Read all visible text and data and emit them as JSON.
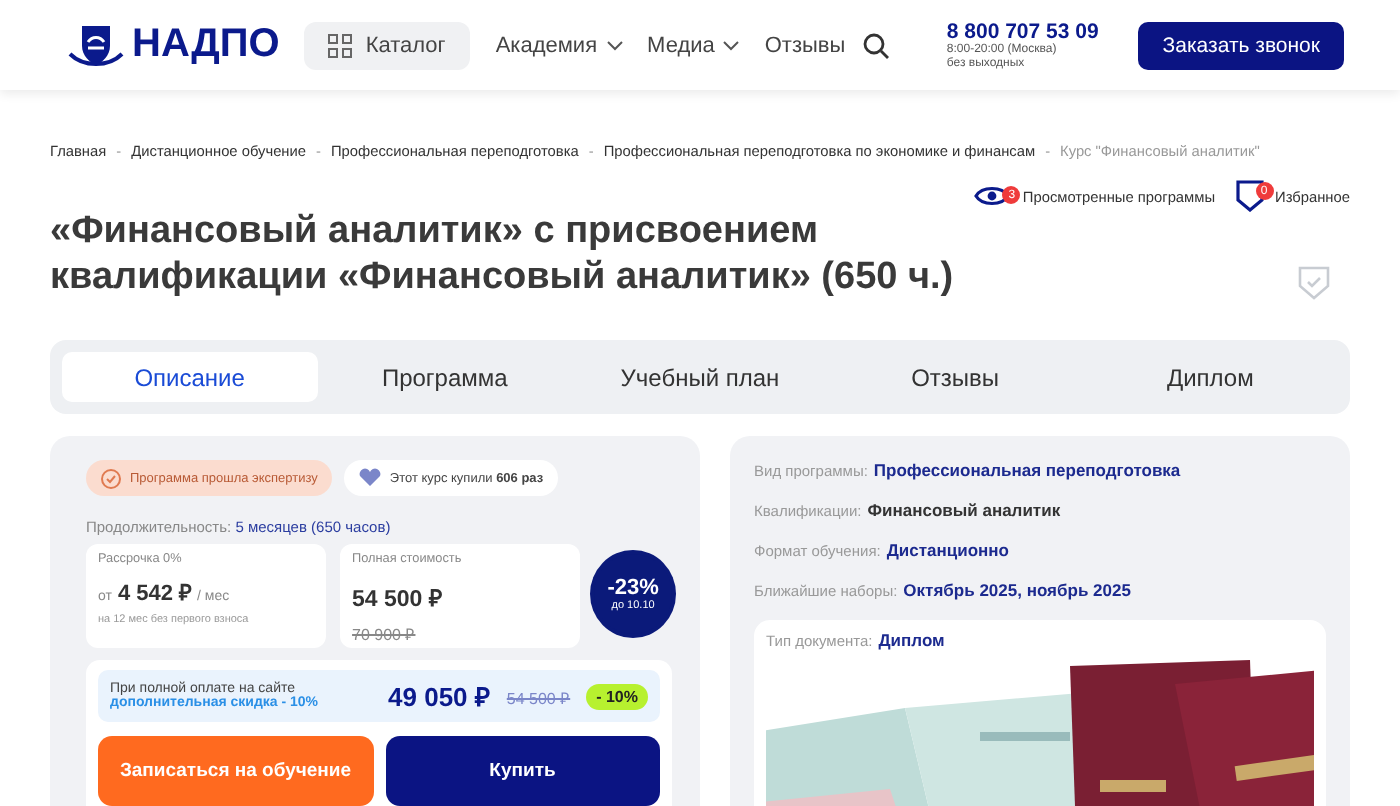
{
  "header": {
    "logo": "НАДПО",
    "catalog": "Каталог",
    "nav": [
      {
        "label": "Академия",
        "dropdown": true
      },
      {
        "label": "Медиа",
        "dropdown": true
      },
      {
        "label": "Отзывы",
        "dropdown": false
      }
    ],
    "phone": "8 800 707 53 09",
    "hours": "8:00-20:00 (Москва)",
    "days": "без выходных",
    "call_button": "Заказать звонок"
  },
  "breadcrumbs": [
    {
      "label": "Главная",
      "current": false
    },
    {
      "sep": "-",
      "label": "Дистанционное обучение",
      "current": false
    },
    {
      "sep": "-",
      "label": "Профессиональная переподготовка",
      "current": false
    },
    {
      "sep": "-",
      "label": "Профессиональная переподготовка по экономике и финансам",
      "current": false
    },
    {
      "sep": "-",
      "label": "Курс \"Финансовый аналитик\"",
      "current": true
    }
  ],
  "user_links": [
    {
      "kind": "viewed",
      "label": "Просмотренные программы",
      "badge": "3"
    },
    {
      "kind": "favorites",
      "label": "Избранное",
      "badge": "0"
    }
  ],
  "title": "«Финансовый аналитик» с присвоением квалификации «Финансовый аналитик» (650 ч.)",
  "tabs": [
    {
      "label": "Описание",
      "selected": true
    },
    {
      "label": "Программа",
      "selected": false
    },
    {
      "label": "Учебный план",
      "selected": false
    },
    {
      "label": "Отзывы",
      "selected": false
    },
    {
      "label": "Диплом",
      "selected": false
    }
  ],
  "offer": {
    "expertise": "Программа прошла экспертизу",
    "bought": "Этот курс купили **606 раз**",
    "duration_label": "Продолжительность:",
    "duration": "5 месяцев (650 часов)",
    "installment": {
      "label": "Рассрочка 0%",
      "prefix": "от",
      "price": "4 542 ₽",
      "suffix": "/ мес",
      "note": "на 12 мес без первого взноса"
    },
    "full": {
      "label": "Полная стоимость",
      "price": "54 500 ₽",
      "old": "70 900 ₽"
    },
    "discount_badge": {
      "percent": "-23%",
      "until": "до 10.10"
    },
    "site_offer": {
      "line1": "При полной оплате на сайте",
      "line2": "дополнительная скидка - 10%",
      "price": "49 050 ₽",
      "old": "54 500 ₽",
      "badge": "- 10%"
    },
    "enroll_button": "Записаться на обучение",
    "buy_button": "Купить"
  },
  "info": [
    {
      "label": "Вид программы:",
      "value": "Профессиональная переподготовка",
      "accent": true
    },
    {
      "label": "Квалификации:",
      "value": "Финансовый аналитик",
      "accent": false
    },
    {
      "label": "Формат обучения:",
      "value": "Дистанционно",
      "accent": true
    },
    {
      "label": "Ближайшие наборы:",
      "value": "Октябрь 2025, ноябрь 2025",
      "accent": true
    }
  ],
  "document": {
    "label": "Тип документа:",
    "value": "Диплом",
    "kind": "picture"
  }
}
